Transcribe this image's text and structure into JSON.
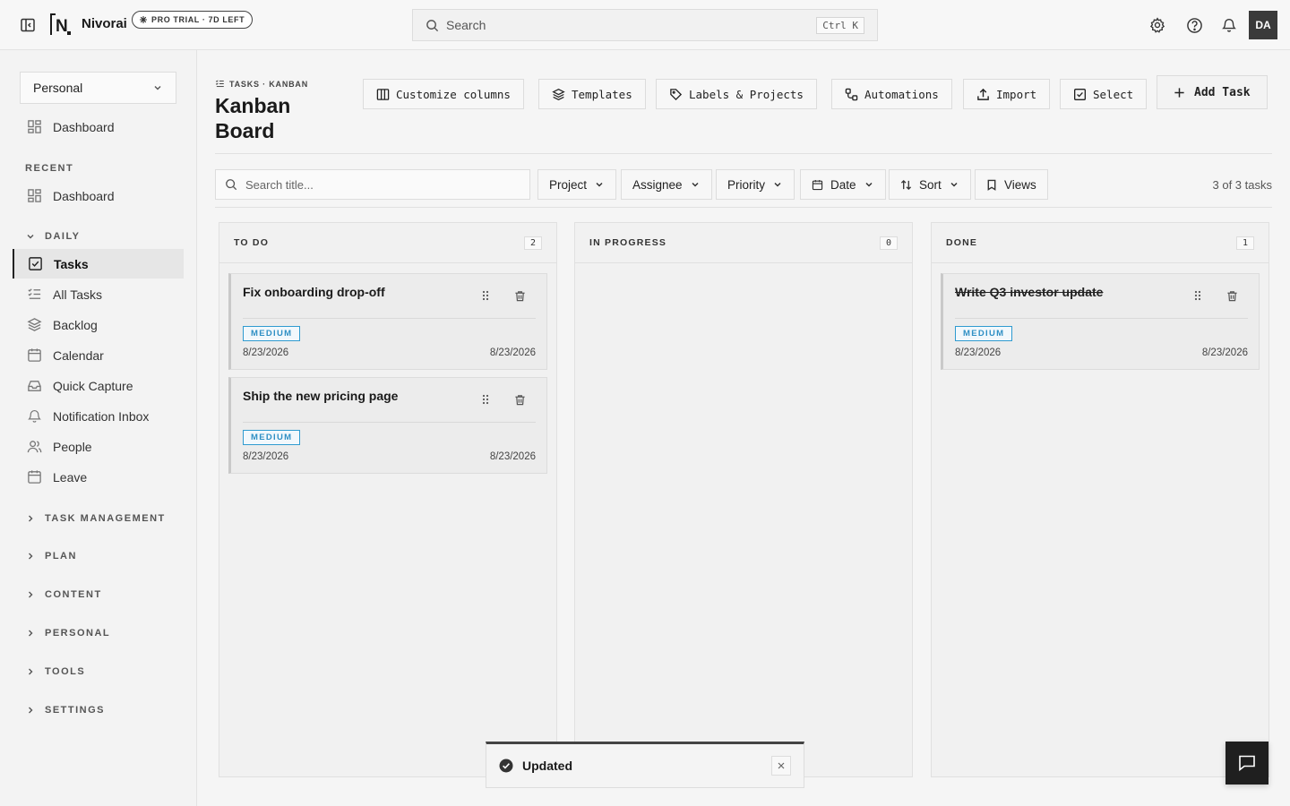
{
  "app": {
    "brand": "Nivorai",
    "trial_badge": "PRO TRIAL · 7D LEFT"
  },
  "topbar": {
    "search_placeholder": "Search",
    "shortcut": "Ctrl K",
    "avatar_initials": "DA"
  },
  "sidebar": {
    "workspace": "Personal",
    "top_item": "Dashboard",
    "recent_label": "RECENT",
    "recent_item": "Dashboard",
    "daily_label": "DAILY",
    "items": [
      "Tasks",
      "All Tasks",
      "Backlog",
      "Calendar",
      "Quick Capture",
      "Notification Inbox",
      "People",
      "Leave"
    ],
    "sections": [
      "TASK MANAGEMENT",
      "PLAN",
      "CONTENT",
      "PERSONAL",
      "TOOLS",
      "SETTINGS"
    ]
  },
  "page": {
    "breadcrumb": "TASKS · KANBAN",
    "title": "Kanban Board",
    "toolbar": {
      "customize": "Customize columns",
      "templates": "Templates",
      "labels": "Labels & Projects",
      "automations": "Automations",
      "import": "Import",
      "select": "Select",
      "add": "Add Task"
    },
    "filters": {
      "search_placeholder": "Search title...",
      "project": "Project",
      "assignee": "Assignee",
      "priority": "Priority",
      "date": "Date",
      "sort": "Sort",
      "views": "Views",
      "count": "3 of 3 tasks"
    }
  },
  "columns": [
    {
      "title": "TO DO",
      "count": "2",
      "cards": [
        {
          "title": "Fix onboarding drop-off",
          "priority": "MEDIUM",
          "date_left": "8/23/2026",
          "date_right": "8/23/2026"
        },
        {
          "title": "Ship the new pricing page",
          "priority": "MEDIUM",
          "date_left": "8/23/2026",
          "date_right": "8/23/2026"
        }
      ]
    },
    {
      "title": "IN PROGRESS",
      "count": "0",
      "cards": []
    },
    {
      "title": "DONE",
      "count": "1",
      "cards": [
        {
          "title": "Write Q3 investor update",
          "priority": "MEDIUM",
          "date_left": "8/23/2026",
          "date_right": "8/23/2026"
        }
      ]
    }
  ],
  "toast": {
    "message": "Updated"
  },
  "colors": {
    "accent": "#2f9bd0",
    "dark": "#1f1f1f"
  }
}
